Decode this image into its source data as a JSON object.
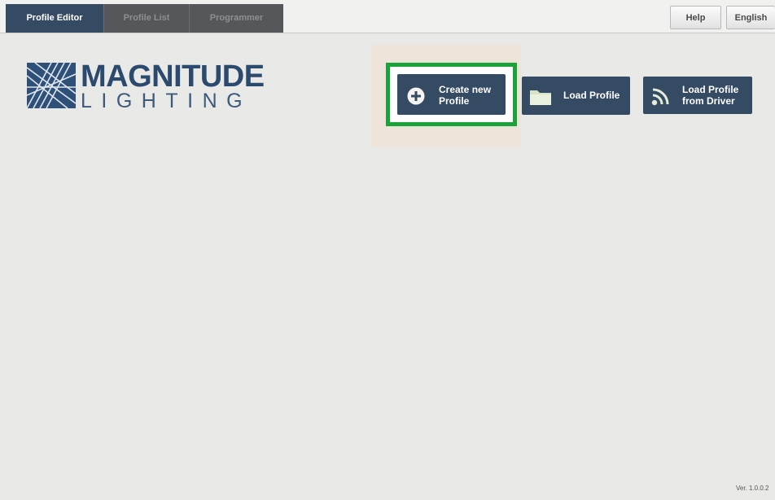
{
  "tabs": [
    {
      "label": "Profile Editor",
      "active": true
    },
    {
      "label": "Profile List",
      "active": false
    },
    {
      "label": "Programmer",
      "active": false
    }
  ],
  "header": {
    "help_label": "Help",
    "language_label": "English"
  },
  "logo": {
    "main": "MAGNITUDE",
    "sub": "LIGHTING"
  },
  "actions": {
    "create_label": "Create new\nProfile",
    "create_icon": "plus-circle-icon",
    "load_label": "Load Profile",
    "load_icon": "folder-icon",
    "driver_label": "Load Profile\nfrom Driver",
    "driver_icon": "wireless-signal-icon"
  },
  "footer": {
    "version": "Ver. 1.0.0.2"
  },
  "colors": {
    "navy": "#354a63",
    "tab_inactive": "#55575a",
    "highlight_green": "#1aa33a",
    "background": "#e9e9e7"
  }
}
